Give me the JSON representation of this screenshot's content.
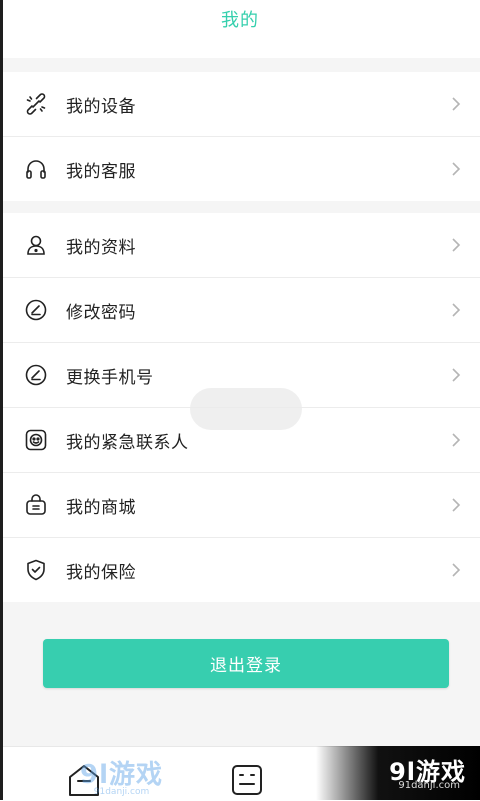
{
  "header": {
    "title": "我的"
  },
  "groups": [
    {
      "items": [
        {
          "label": "我的设备",
          "icon": "device-link-icon"
        },
        {
          "label": "我的客服",
          "icon": "headset-icon"
        }
      ]
    },
    {
      "items": [
        {
          "label": "我的资料",
          "icon": "user-profile-icon"
        },
        {
          "label": "修改密码",
          "icon": "edit-circle-icon"
        },
        {
          "label": "更换手机号",
          "icon": "edit-circle-icon"
        },
        {
          "label": "我的紧急联系人",
          "icon": "emergency-contact-icon"
        },
        {
          "label": "我的商城",
          "icon": "shop-basket-icon"
        },
        {
          "label": "我的保险",
          "icon": "shield-check-icon"
        }
      ]
    }
  ],
  "logout": {
    "label": "退出登录"
  },
  "watermark": {
    "brand": "9l游戏",
    "domain": "91danji.com"
  },
  "colors": {
    "accent": "#37ceaf",
    "title": "#35cfad"
  }
}
